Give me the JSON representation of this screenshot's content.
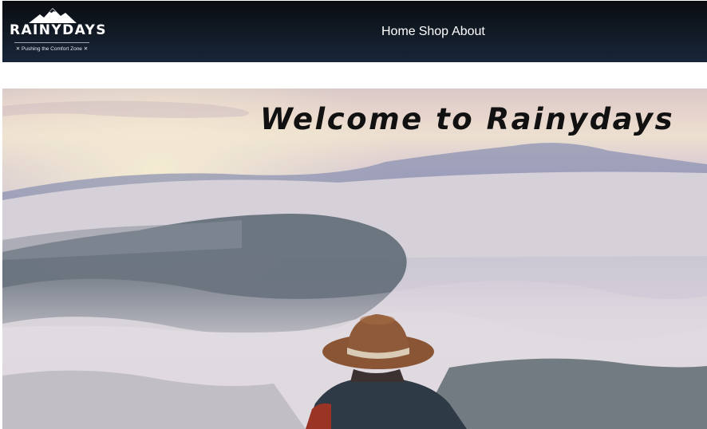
{
  "header": {
    "logo": {
      "name": "RAINYDAYS",
      "tagline": "✕ Pushing the Comfort Zone ✕",
      "icon": "mountain-icon"
    },
    "nav": [
      {
        "label": "Home"
      },
      {
        "label": "Shop"
      },
      {
        "label": "About"
      }
    ]
  },
  "hero": {
    "title": "Welcome to Rainydays",
    "image": "hiker-above-clouds-photo"
  },
  "colors": {
    "header_bg": "#0e1620",
    "header_text": "#ffffff",
    "hero_title": "#111111"
  }
}
